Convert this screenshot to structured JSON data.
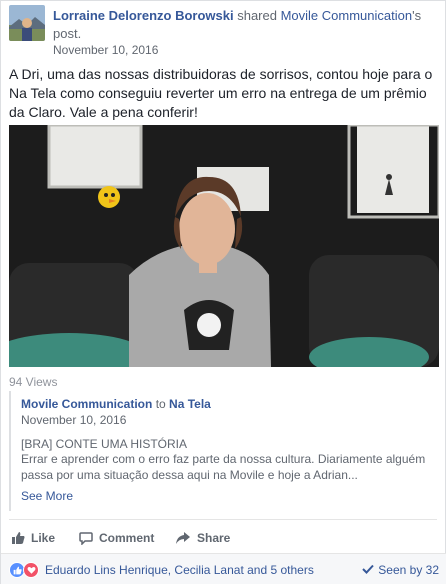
{
  "post": {
    "author": "Lorraine Delorenzo Borowski",
    "shared_text": "shared",
    "page": "Movile Communication",
    "suffix": "'s post.",
    "date": "November 10, 2016",
    "body": "A Dri, uma das nossas distribuidoras de sorrisos, contou hoje para o Na Tela como conseguiu reverter um erro na entrega de um prêmio da Claro. Vale a pena conferir!"
  },
  "video": {
    "views": "94 Views"
  },
  "shared": {
    "from": "Movile Communication",
    "to_word": "to",
    "to": "Na Tela",
    "date": "November 10, 2016",
    "tag": "[BRA] CONTE UMA HISTÓRIA",
    "text": "Errar e aprender com o erro faz parte da nossa cultura. Diariamente alguém passa por uma situação dessa aqui na Movile e hoje a Adrian...",
    "see_more": "See More"
  },
  "actions": {
    "like": "Like",
    "comment": "Comment",
    "share": "Share"
  },
  "reactions": {
    "names": "Eduardo Lins Henrique, Cecilia Lanat and 5 others",
    "seen": "Seen by 32",
    "like_color": "#5890ff",
    "love_color": "#f25268"
  }
}
